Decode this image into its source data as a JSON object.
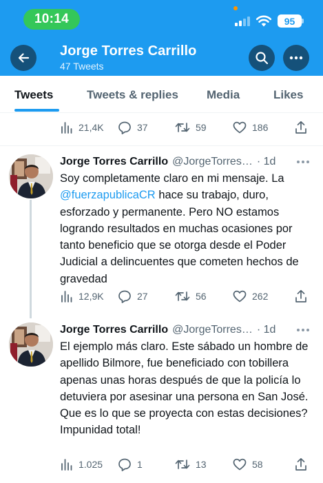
{
  "status_bar": {
    "time": "10:14",
    "battery": "95"
  },
  "header": {
    "title": "Jorge Torres Carrillo",
    "subtitle": "47 Tweets",
    "background": "#1d9bf0"
  },
  "tabs": [
    {
      "label": "Tweets",
      "active": true
    },
    {
      "label": "Tweets & replies",
      "active": false
    },
    {
      "label": "Media",
      "active": false
    },
    {
      "label": "Likes",
      "active": false
    }
  ],
  "top_actions": {
    "views": "21,4K",
    "replies": "37",
    "retweets": "59",
    "likes": "186"
  },
  "tweets": [
    {
      "name": "Jorge Torres Carrillo",
      "handle": "@JorgeTorres…",
      "time": "· 1d",
      "text_before": "Soy completamente claro en mi mensaje. La ",
      "mention": "@fuerzapublicaCR",
      "text_after": " hace su trabajo, duro, esforzado y permanente. Pero NO estamos logrando resultados en muchas ocasiones por tanto beneficio que se otorga desde el Poder Judicial a delincuentes que cometen hechos de gravedad",
      "views": "12,9K",
      "replies": "27",
      "retweets": "56",
      "likes": "262"
    },
    {
      "name": "Jorge Torres Carrillo",
      "handle": "@JorgeTorres…",
      "time": "· 1d",
      "text": "El ejemplo más claro. Este sábado un hombre de apellido Bilmore, fue beneficiado con tobillera apenas unas horas después de que la policía lo detuviera por asesinar una persona en San José. Que es lo que se proyecta con estas decisiones? Impunidad total!",
      "views": "1.025",
      "replies": "1",
      "retweets": "13",
      "likes": "58"
    }
  ],
  "colors": {
    "accent": "#1d9bf0",
    "text": "#0f1419",
    "muted": "#536471"
  }
}
